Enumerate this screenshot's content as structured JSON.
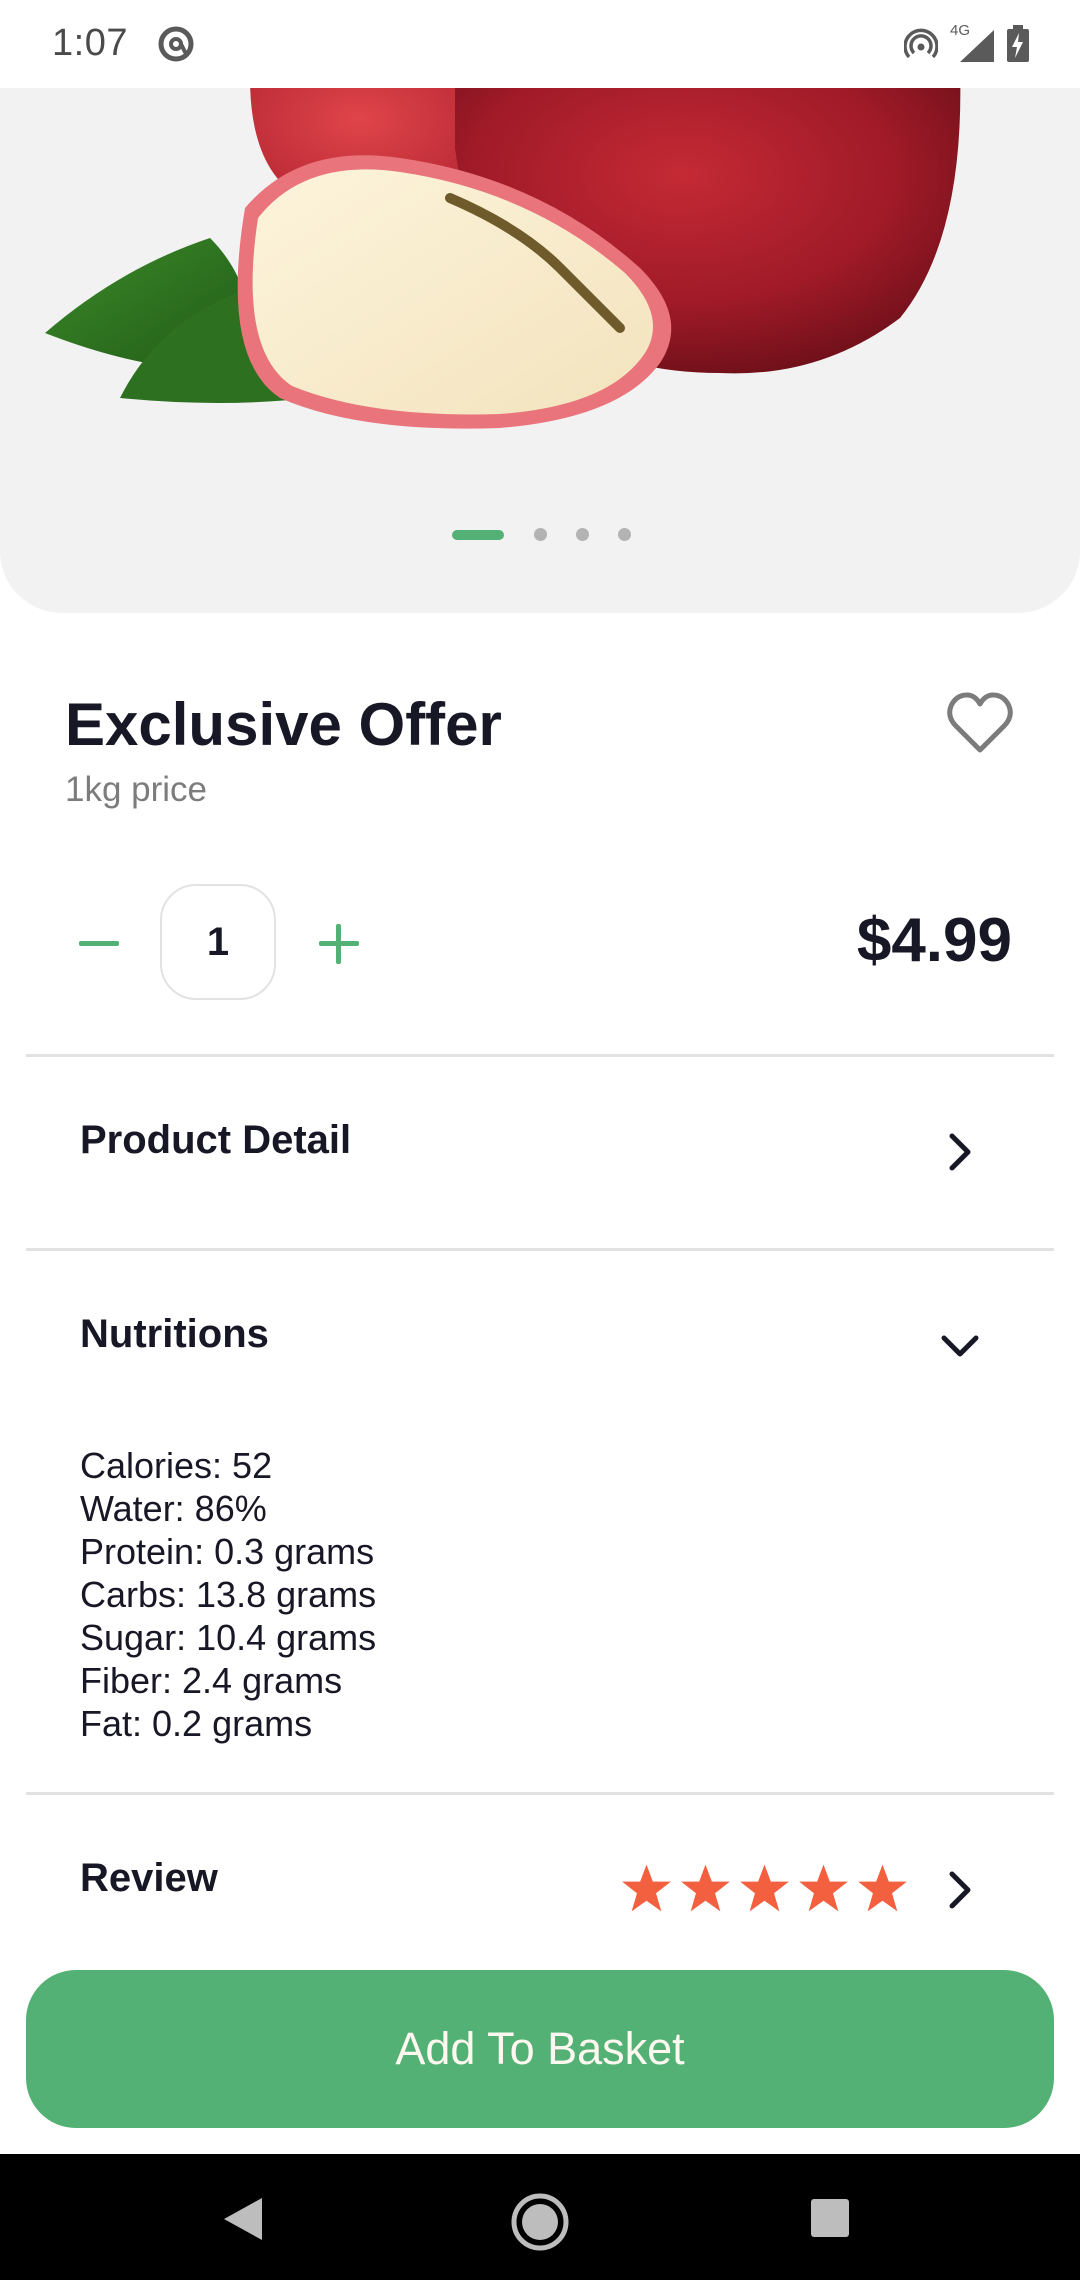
{
  "status_bar": {
    "time": "1:07",
    "icons": [
      "at-sign-icon",
      "hotspot-icon",
      "signal-4g-icon",
      "battery-charging-icon"
    ],
    "network_label": "4G"
  },
  "carousel": {
    "image": "red-apple-with-slice",
    "page_count": 4,
    "active_index": 0
  },
  "product": {
    "title": "Exclusive Offer",
    "subtitle": "1kg price",
    "quantity": "1",
    "price": "$4.99",
    "favorite_icon": "heart-outline-icon"
  },
  "sections": {
    "product_detail": {
      "label": "Product Detail",
      "icon": "chevron-right-icon"
    },
    "nutritions": {
      "label": "Nutritions",
      "icon": "chevron-down-icon",
      "items": [
        "Calories: 52",
        "Water: 86%",
        "Protein: 0.3 grams",
        "Carbs: 13.8 grams",
        "Sugar: 10.4 grams",
        "Fiber: 2.4 grams",
        "Fat: 0.2 grams"
      ]
    },
    "review": {
      "label": "Review",
      "rating": 5,
      "max_rating": 5,
      "icon": "chevron-right-icon"
    }
  },
  "cta": {
    "label": "Add To Basket"
  },
  "colors": {
    "accent": "#53B175",
    "star": "#F3603F",
    "title": "#181725",
    "muted": "#7C7C7C",
    "hero_bg": "#F2F2F2"
  }
}
